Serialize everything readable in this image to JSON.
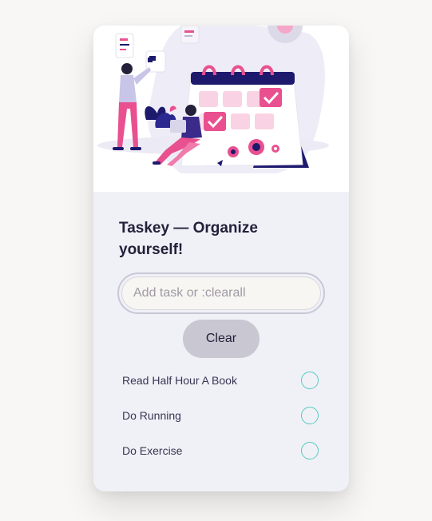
{
  "app": {
    "title": "Taskey — Organize yourself!"
  },
  "input": {
    "value": "",
    "placeholder": "Add task or :clearall"
  },
  "actions": {
    "clear_label": "Clear"
  },
  "tasks": [
    {
      "label": "Read Half Hour A Book",
      "done": false
    },
    {
      "label": "Do Running",
      "done": false
    },
    {
      "label": "Do Exercise",
      "done": false
    }
  ],
  "colors": {
    "accent_pink": "#e8508f",
    "accent_navy": "#1d1a6e",
    "check_border": "#5cc9c0",
    "card_bg": "#eff1f7"
  },
  "icons": {
    "hero": "calendar-planning-illustration",
    "task_toggle": "empty-circle-checkbox"
  }
}
